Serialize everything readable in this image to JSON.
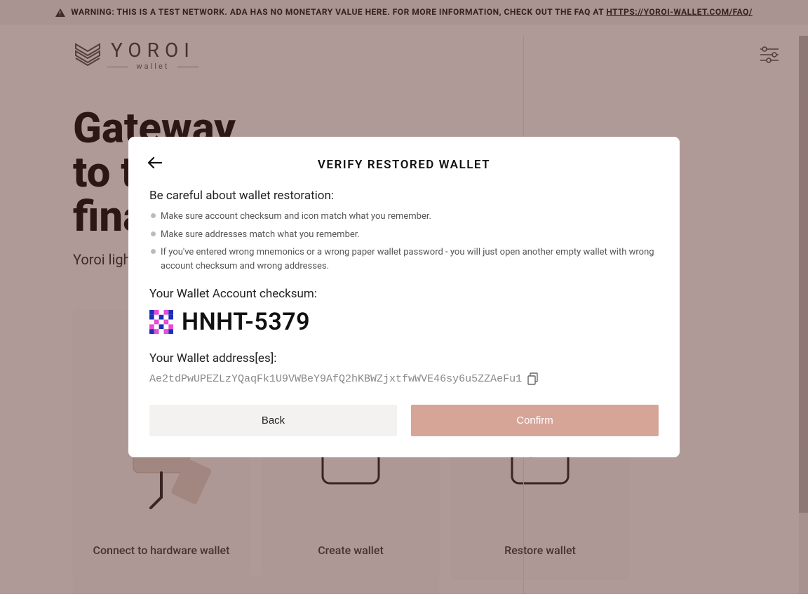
{
  "warning": {
    "text_prefix": "WARNING: THIS IS A TEST NETWORK. ADA HAS NO MONETARY VALUE HERE. FOR MORE INFORMATION, CHECK OUT THE FAQ AT ",
    "link": "HTTPS://YOROI-WALLET.COM/FAQ/"
  },
  "logo": {
    "name": "YOROI",
    "subtitle": "wallet"
  },
  "hero": {
    "title_line1": "Gateway",
    "title_line2": "to the",
    "title_line3": "financial world",
    "subtitle": "Yoroi light wallet for Cardano assets"
  },
  "cards": [
    {
      "title": "Connect to hardware wallet"
    },
    {
      "title": "Create wallet"
    },
    {
      "title": "Restore wallet"
    }
  ],
  "modal": {
    "title": "VERIFY RESTORED WALLET",
    "careful": "Be careful about wallet restoration:",
    "bullets": [
      "Make sure account checksum and icon match what you remember.",
      "Make sure addresses match what you remember.",
      "If you've entered wrong mnemonics or a wrong paper wallet password - you will just open another empty wallet with wrong account checksum and wrong addresses."
    ],
    "checksum_label": "Your Wallet Account checksum:",
    "checksum_code": "HNHT-5379",
    "addresses_label": "Your Wallet address[es]:",
    "address": "Ae2tdPwUPEZLzYQaqFk1U9VWBeY9AfQ2hKBWZjxtfwWVE46sy6u5ZZAeFu1",
    "back_label": "Back",
    "confirm_label": "Confirm"
  },
  "colors": {
    "accent": "#d7a598",
    "overlay": "rgba(80,30,25,0.45)"
  }
}
